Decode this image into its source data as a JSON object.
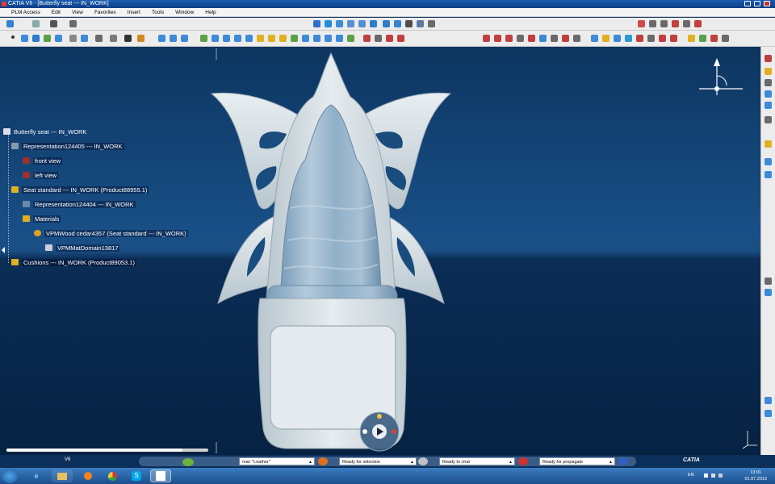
{
  "window": {
    "title": "CATIA V6 - [Butterfly seat --- IN_WORK]"
  },
  "menu": [
    "PLM Access",
    "Edit",
    "View",
    "Favorites",
    "Insert",
    "Tools",
    "Window",
    "Help"
  ],
  "tree": {
    "root": "Butterfly seat --- IN_WORK",
    "representation1": "Representation124405 --- IN_WORK",
    "front_view": "front view",
    "left_view": "left view",
    "seat_standard": "Seat standard --- IN_WORK (Product88955.1)",
    "representation2": "Representation124404 --- IN_WORK",
    "materials": "Materials",
    "material": "VPMWood cedar4357 (Seat standard --- IN_WORK)",
    "domain": "VPMMatDomain13817",
    "cushions": "Cushions --- IN_WORK (Product89053.1)"
  },
  "status": {
    "field1": "mat: \"Leather\"",
    "field2": "Ready for selection",
    "field3": "Ready to chat",
    "field4": "Ready for propagate"
  },
  "taskbar": {
    "v6_label": "V6",
    "lang": "EN",
    "time": "13:01",
    "date": "01.07.2013",
    "brand": "CATIA"
  },
  "icons": {
    "compass": "compass-icon",
    "axis": "axis-triad-icon",
    "play": "play-icon"
  },
  "colors": {
    "viewport_top": "#0d3560",
    "viewport_bottom": "#062243",
    "taskbar": "#2a66a8",
    "title": "#1a5bb0"
  }
}
